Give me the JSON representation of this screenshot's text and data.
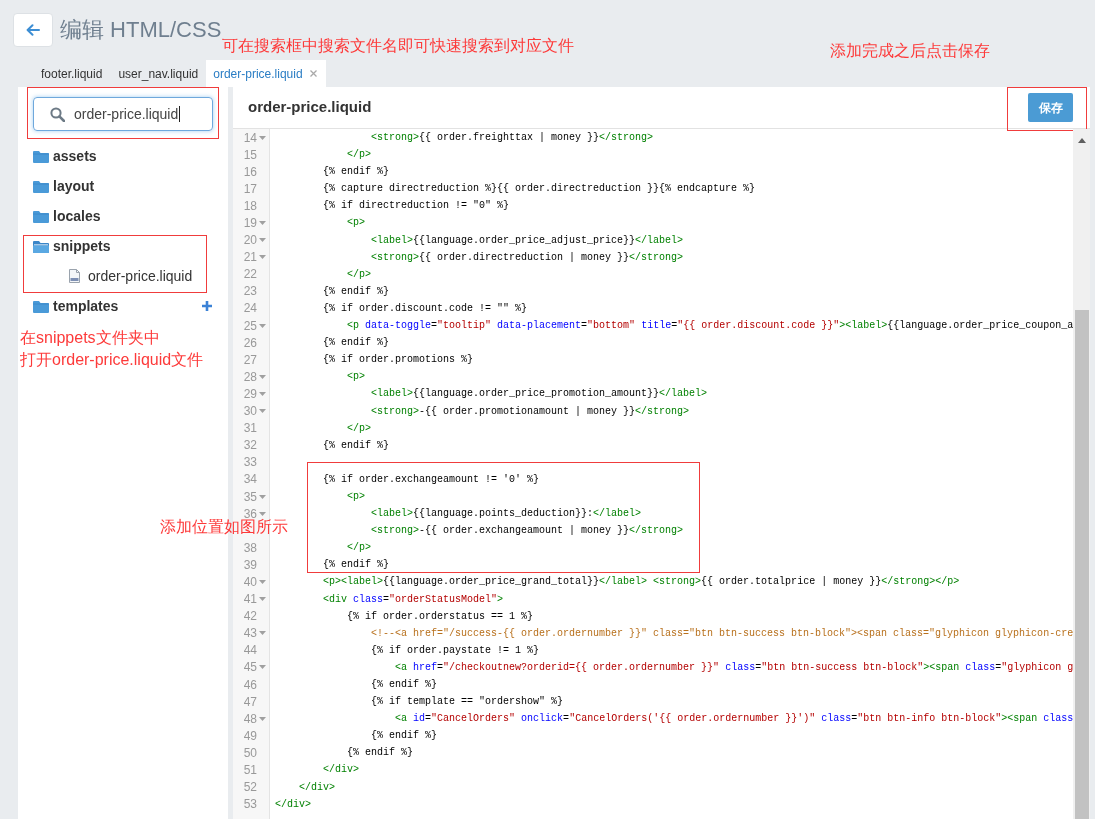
{
  "header": {
    "title": "编辑 HTML/CSS"
  },
  "tabs": [
    {
      "label": "footer.liquid",
      "selected": false
    },
    {
      "label": "user_nav.liquid",
      "selected": false
    },
    {
      "label": "order-price.liquid",
      "selected": true
    }
  ],
  "sidebar": {
    "search": {
      "value": "order-price.liquid",
      "focused": true
    },
    "tree": [
      {
        "kind": "folder",
        "label": "assets",
        "expanded": false,
        "hovered": false
      },
      {
        "kind": "folder",
        "label": "layout",
        "expanded": false,
        "hovered": false
      },
      {
        "kind": "folder",
        "label": "locales",
        "expanded": false,
        "hovered": false
      },
      {
        "kind": "folder",
        "label": "snippets",
        "expanded": true,
        "hovered": false,
        "children": [
          {
            "kind": "file",
            "label": "order-price.liquid"
          }
        ]
      },
      {
        "kind": "folder",
        "label": "templates",
        "expanded": false,
        "hovered": true
      }
    ]
  },
  "editor": {
    "file_title": "order-price.liquid",
    "save_button": {
      "label": "保存"
    },
    "lines": [
      {
        "number": "14",
        "fold": true,
        "tokens": [
          {
            "kind": "tag",
            "text": "                <strong>"
          },
          {
            "kind": "text",
            "text": "{{ order.freighttax | money }}"
          },
          {
            "kind": "tag",
            "text": "</strong>"
          }
        ]
      },
      {
        "number": "15",
        "fold": false,
        "tokens": [
          {
            "kind": "tag",
            "text": "            </p>"
          }
        ]
      },
      {
        "number": "16",
        "fold": false,
        "tokens": [
          {
            "kind": "text",
            "text": "        {% endif %}"
          }
        ]
      },
      {
        "number": "17",
        "fold": false,
        "tokens": [
          {
            "kind": "text",
            "text": "        {% capture directreduction %}{{ order.directreduction }}{% endcapture %}"
          }
        ]
      },
      {
        "number": "18",
        "fold": false,
        "tokens": [
          {
            "kind": "text",
            "text": "        {% if directreduction != \"0\" %}"
          }
        ]
      },
      {
        "number": "19",
        "fold": true,
        "tokens": [
          {
            "kind": "tag",
            "text": "            <p>"
          }
        ]
      },
      {
        "number": "20",
        "fold": true,
        "tokens": [
          {
            "kind": "tag",
            "text": "                <label>"
          },
          {
            "kind": "text",
            "text": "{{language.order_price_adjust_price}}"
          },
          {
            "kind": "tag",
            "text": "</label>"
          }
        ]
      },
      {
        "number": "21",
        "fold": true,
        "tokens": [
          {
            "kind": "tag",
            "text": "                <strong>"
          },
          {
            "kind": "text",
            "text": "{{ order.directreduction | money }}"
          },
          {
            "kind": "tag",
            "text": "</strong>"
          }
        ]
      },
      {
        "number": "22",
        "fold": false,
        "tokens": [
          {
            "kind": "tag",
            "text": "            </p>"
          }
        ]
      },
      {
        "number": "23",
        "fold": false,
        "tokens": [
          {
            "kind": "text",
            "text": "        {% endif %}"
          }
        ]
      },
      {
        "number": "24",
        "fold": false,
        "tokens": [
          {
            "kind": "text",
            "text": "        {% if order.discount.code != \"\" %}"
          }
        ]
      },
      {
        "number": "25",
        "fold": true,
        "tokens": [
          {
            "kind": "tag",
            "text": "            <p"
          },
          {
            "kind": "attr",
            "text": " data-toggle"
          },
          {
            "kind": "text",
            "text": "="
          },
          {
            "kind": "value",
            "text": "\"tooltip\""
          },
          {
            "kind": "attr",
            "text": " data-placement"
          },
          {
            "kind": "text",
            "text": "="
          },
          {
            "kind": "value",
            "text": "\"bottom\""
          },
          {
            "kind": "attr",
            "text": " title"
          },
          {
            "kind": "text",
            "text": "="
          },
          {
            "kind": "value",
            "text": "\"{{ order.discount.code }}\""
          },
          {
            "kind": "tag",
            "text": "><label>"
          },
          {
            "kind": "text",
            "text": "{{language.order_price_coupon_a"
          }
        ]
      },
      {
        "number": "26",
        "fold": false,
        "tokens": [
          {
            "kind": "text",
            "text": "        {% endif %}"
          }
        ]
      },
      {
        "number": "27",
        "fold": false,
        "tokens": [
          {
            "kind": "text",
            "text": "        {% if order.promotions %}"
          }
        ]
      },
      {
        "number": "28",
        "fold": true,
        "tokens": [
          {
            "kind": "tag",
            "text": "            <p>"
          }
        ]
      },
      {
        "number": "29",
        "fold": true,
        "tokens": [
          {
            "kind": "tag",
            "text": "                <label>"
          },
          {
            "kind": "text",
            "text": "{{language.order_price_promotion_amount}}"
          },
          {
            "kind": "tag",
            "text": "</label>"
          }
        ]
      },
      {
        "number": "30",
        "fold": true,
        "tokens": [
          {
            "kind": "tag",
            "text": "                <strong>"
          },
          {
            "kind": "text",
            "text": "-{{ order.promotionamount | money }}"
          },
          {
            "kind": "tag",
            "text": "</strong>"
          }
        ]
      },
      {
        "number": "31",
        "fold": false,
        "tokens": [
          {
            "kind": "tag",
            "text": "            </p>"
          }
        ]
      },
      {
        "number": "32",
        "fold": false,
        "tokens": [
          {
            "kind": "text",
            "text": "        {% endif %}"
          }
        ]
      },
      {
        "number": "33",
        "fold": false
      },
      {
        "number": "34",
        "fold": false,
        "tokens": [
          {
            "kind": "text",
            "text": "        {% if order.exchangeamount != '0' %}"
          }
        ]
      },
      {
        "number": "35",
        "fold": true,
        "tokens": [
          {
            "kind": "tag",
            "text": "            <p>"
          }
        ]
      },
      {
        "number": "36",
        "fold": true,
        "tokens": [
          {
            "kind": "tag",
            "text": "                <label>"
          },
          {
            "kind": "text",
            "text": "{{language.points_deduction}}:"
          },
          {
            "kind": "tag",
            "text": "</label>"
          }
        ]
      },
      {
        "fold": false,
        "tokens": [
          {
            "kind": "tag",
            "text": "                <strong>"
          },
          {
            "kind": "text",
            "text": "-{{ order.exchangeamount | money }}"
          },
          {
            "kind": "tag",
            "text": "</strong>"
          }
        ]
      },
      {
        "number": "38",
        "fold": false,
        "tokens": [
          {
            "kind": "tag",
            "text": "            </p>"
          }
        ]
      },
      {
        "number": "39",
        "fold": false,
        "tokens": [
          {
            "kind": "text",
            "text": "        {% endif %}"
          }
        ]
      },
      {
        "number": "40",
        "fold": true,
        "tokens": [
          {
            "kind": "tag",
            "text": "        <p><label>"
          },
          {
            "kind": "text",
            "text": "{{language.order_price_grand_total}}"
          },
          {
            "kind": "tag",
            "text": "</label> <strong>"
          },
          {
            "kind": "text",
            "text": "{{ order.totalprice | money }}"
          },
          {
            "kind": "tag",
            "text": "</strong></p>"
          }
        ]
      },
      {
        "number": "41",
        "fold": true,
        "tokens": [
          {
            "kind": "tag",
            "text": "        <div"
          },
          {
            "kind": "attr",
            "text": " class"
          },
          {
            "kind": "text",
            "text": "="
          },
          {
            "kind": "value",
            "text": "\"orderStatusModel\""
          },
          {
            "kind": "tag",
            "text": ">"
          }
        ]
      },
      {
        "number": "42",
        "fold": false,
        "tokens": [
          {
            "kind": "text",
            "text": "            {% if order.orderstatus == 1 %}"
          }
        ]
      },
      {
        "number": "43",
        "fold": true,
        "tokens": [
          {
            "kind": "comment",
            "text": "                <!--<a href=\"/success-{{ order.ordernumber }}\" class=\"btn btn-success btn-block\"><span class=\"glyphicon glyphicon-cre"
          }
        ]
      },
      {
        "number": "44",
        "fold": false,
        "tokens": [
          {
            "kind": "text",
            "text": "                {% if order.paystate != 1 %}"
          }
        ]
      },
      {
        "number": "45",
        "fold": true,
        "tokens": [
          {
            "kind": "tag",
            "text": "                    <a"
          },
          {
            "kind": "attr",
            "text": " href"
          },
          {
            "kind": "text",
            "text": "="
          },
          {
            "kind": "value",
            "text": "\"/checkoutnew?orderid={{ order.ordernumber }}\""
          },
          {
            "kind": "attr",
            "text": " class"
          },
          {
            "kind": "text",
            "text": "="
          },
          {
            "kind": "value",
            "text": "\"btn btn-success btn-block\""
          },
          {
            "kind": "tag",
            "text": "><span"
          },
          {
            "kind": "attr",
            "text": " class"
          },
          {
            "kind": "text",
            "text": "="
          },
          {
            "kind": "value",
            "text": "\"glyphicon g"
          }
        ]
      },
      {
        "number": "46",
        "fold": false,
        "tokens": [
          {
            "kind": "text",
            "text": "                {% endif %}"
          }
        ]
      },
      {
        "number": "47",
        "fold": false,
        "tokens": [
          {
            "kind": "text",
            "text": "                {% if template == \"ordershow\" %}"
          }
        ]
      },
      {
        "number": "48",
        "fold": true,
        "tokens": [
          {
            "kind": "tag",
            "text": "                    <a"
          },
          {
            "kind": "attr",
            "text": " id"
          },
          {
            "kind": "text",
            "text": "="
          },
          {
            "kind": "value",
            "text": "\"CancelOrders\""
          },
          {
            "kind": "attr",
            "text": " onclick"
          },
          {
            "kind": "text",
            "text": "="
          },
          {
            "kind": "value",
            "text": "\"CancelOrders('{{ order.ordernumber }}')\""
          },
          {
            "kind": "attr",
            "text": " class"
          },
          {
            "kind": "text",
            "text": "="
          },
          {
            "kind": "value",
            "text": "\"btn btn-info btn-block\""
          },
          {
            "kind": "tag",
            "text": "><span"
          },
          {
            "kind": "attr",
            "text": " class"
          }
        ]
      },
      {
        "number": "49",
        "fold": false,
        "tokens": [
          {
            "kind": "text",
            "text": "                {% endif %}"
          }
        ]
      },
      {
        "number": "50",
        "fold": false,
        "tokens": [
          {
            "kind": "text",
            "text": "            {% endif %}"
          }
        ]
      },
      {
        "number": "51",
        "fold": false,
        "tokens": [
          {
            "kind": "tag",
            "text": "        </div>"
          }
        ]
      },
      {
        "number": "52",
        "fold": false,
        "tokens": [
          {
            "kind": "tag",
            "text": "    </div>"
          }
        ]
      },
      {
        "number": "53",
        "fold": false,
        "tokens": [
          {
            "kind": "tag",
            "text": "</div>"
          }
        ]
      }
    ]
  },
  "annotations": {
    "search_hint": "可在搜索框中搜索文件名即可快速搜索到对应文件",
    "save_hint": "添加完成之后点击保存",
    "folder_hint": [
      "在snippets文件夹中",
      "打开order-price.liquid文件"
    ],
    "insert_hint": "添加位置如图所示"
  }
}
